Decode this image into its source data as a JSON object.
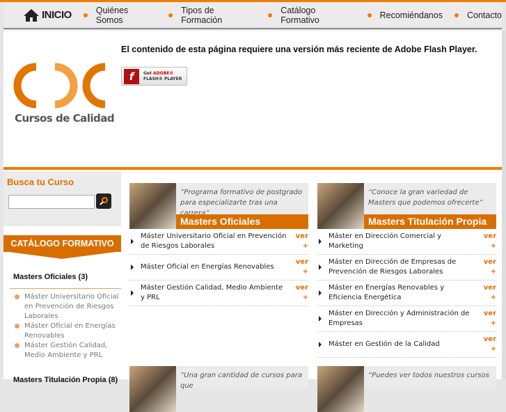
{
  "nav": {
    "home": "INICIO",
    "items": [
      "Quiénes Somos",
      "Tipos de Formación",
      "Catálogo Formativo",
      "Recomiéndanos",
      "Contacto"
    ]
  },
  "header": {
    "logo_text": "Cursos de Calidad",
    "flash_message": "El contenido de esta página requiere una versión más reciente de Adobe Flash Player.",
    "flash_button": {
      "line1": "Get",
      "brand": "ADOBE®",
      "line2": "FLASH® PLAYER"
    }
  },
  "sidebar": {
    "search_title": "Busca tu Curso",
    "search_value": "",
    "catalog_title": "CATÁLOGO FORMATIVO",
    "group1": "Masters Oficiales (3)",
    "group1_items": [
      "Máster Universitario Oficial en Prevención de Riesgos Laborales",
      "Máster Oficial en Energías Renovables",
      "Máster Gestión Calidad, Medio Ambiente y PRL"
    ],
    "group2": "Masters Titulación Propia (8)"
  },
  "boxes": [
    {
      "quote": "“Programa formativo de postgrado para especializarte tras una carrera”",
      "title": "Masters Oficiales",
      "items": [
        "Máster Universitario Oficial en Prevención de Riesgos Laborales",
        "Máster Oficial en Energías Renovables",
        "Máster Gestión Calidad, Medio Ambiente y PRL"
      ]
    },
    {
      "quote": "“Conoce la gran variedad de Masters que podemos ofrecerte”",
      "title": "Masters Titulación Propia",
      "items": [
        "Máster en Dirección Comercial y Marketing",
        "Máster en Dirección de Empresas de Prevención de Riesgos Laborales",
        "Máster en Energías Renovables y Eficiencia Energética",
        "Máster en Dirección y Administración de Empresas",
        "Máster en Gestión de la Calidad"
      ]
    },
    {
      "quote": "“Una gran cantidad de cursos para que"
    },
    {
      "quote": "“Puedes ver todos nuestros cursos"
    }
  ],
  "ver_label": "ver +",
  "colors": {
    "accent": "#f07d00",
    "banner": "#d96e00"
  }
}
